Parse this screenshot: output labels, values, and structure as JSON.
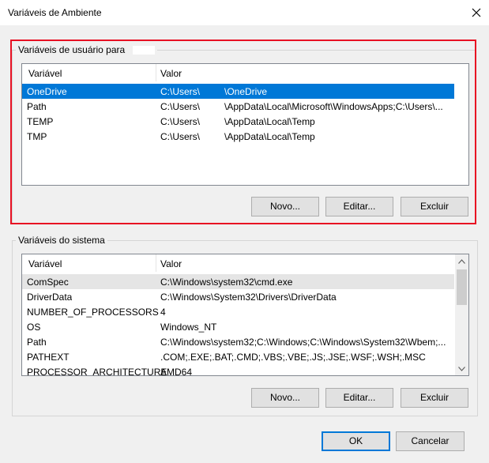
{
  "window": {
    "title": "Variáveis de Ambiente"
  },
  "user_vars": {
    "group_label": "Variáveis de usuário para",
    "columns": [
      "Variável",
      "Valor"
    ],
    "rows": [
      {
        "name": "OneDrive",
        "value_a": "C:\\Users\\",
        "value_b": "\\OneDrive"
      },
      {
        "name": "Path",
        "value_a": "C:\\Users\\",
        "value_b": "\\AppData\\Local\\Microsoft\\WindowsApps;C:\\Users\\..."
      },
      {
        "name": "TEMP",
        "value_a": "C:\\Users\\",
        "value_b": "\\AppData\\Local\\Temp"
      },
      {
        "name": "TMP",
        "value_a": "C:\\Users\\",
        "value_b": "\\AppData\\Local\\Temp"
      }
    ],
    "buttons": {
      "new": "Novo...",
      "edit": "Editar...",
      "delete": "Excluir"
    }
  },
  "system_vars": {
    "group_label": "Variáveis do sistema",
    "columns": [
      "Variável",
      "Valor"
    ],
    "rows": [
      {
        "name": "ComSpec",
        "value": "C:\\Windows\\system32\\cmd.exe"
      },
      {
        "name": "DriverData",
        "value": "C:\\Windows\\System32\\Drivers\\DriverData"
      },
      {
        "name": "NUMBER_OF_PROCESSORS",
        "value": "4"
      },
      {
        "name": "OS",
        "value": "Windows_NT"
      },
      {
        "name": "Path",
        "value": "C:\\Windows\\system32;C:\\Windows;C:\\Windows\\System32\\Wbem;..."
      },
      {
        "name": "PATHEXT",
        "value": ".COM;.EXE;.BAT;.CMD;.VBS;.VBE;.JS;.JSE;.WSF;.WSH;.MSC"
      },
      {
        "name": "PROCESSOR_ARCHITECTURE",
        "value": "AMD64"
      }
    ],
    "buttons": {
      "new": "Novo...",
      "edit": "Editar...",
      "delete": "Excluir"
    }
  },
  "footer": {
    "ok": "OK",
    "cancel": "Cancelar"
  },
  "colors": {
    "selection": "#0078d7",
    "highlight_border": "#e81123"
  },
  "icons": {
    "close": "close-icon",
    "scroll_up": "chevron-up-icon",
    "scroll_down": "chevron-down-icon"
  }
}
